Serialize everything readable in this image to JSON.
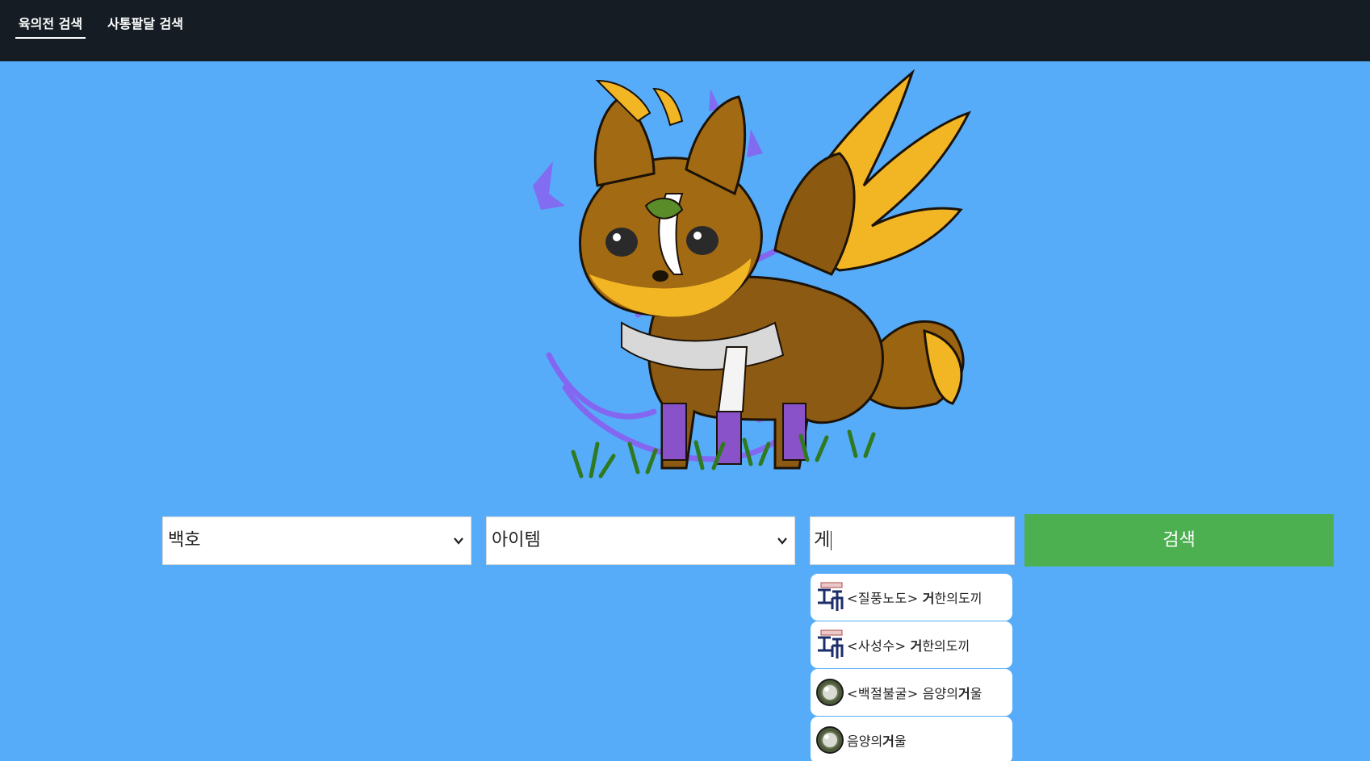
{
  "nav": {
    "tabs": [
      {
        "label": "육의전 검색",
        "active": true
      },
      {
        "label": "사통팔달 검색",
        "active": false
      }
    ]
  },
  "search": {
    "server": "백호",
    "category": "아이템",
    "query": "게",
    "button_label": "검색"
  },
  "suggestions": [
    {
      "icon": "scroll-icon",
      "tag": "<질풍노도>",
      "highlight": "거",
      "rest": "한의도끼"
    },
    {
      "icon": "scroll-icon",
      "tag": "<사성수>",
      "highlight": "거",
      "rest": "한의도끼"
    },
    {
      "icon": "mirror-icon",
      "tag": "<백절불굴>",
      "pre": "음양의",
      "highlight": "거",
      "rest": "울"
    },
    {
      "icon": "mirror-icon",
      "pre": "음양의",
      "highlight": "거",
      "rest": "울"
    }
  ],
  "colors": {
    "nav_background": "#151c24",
    "page_background": "#57acf9",
    "search_button": "#4caf50"
  }
}
